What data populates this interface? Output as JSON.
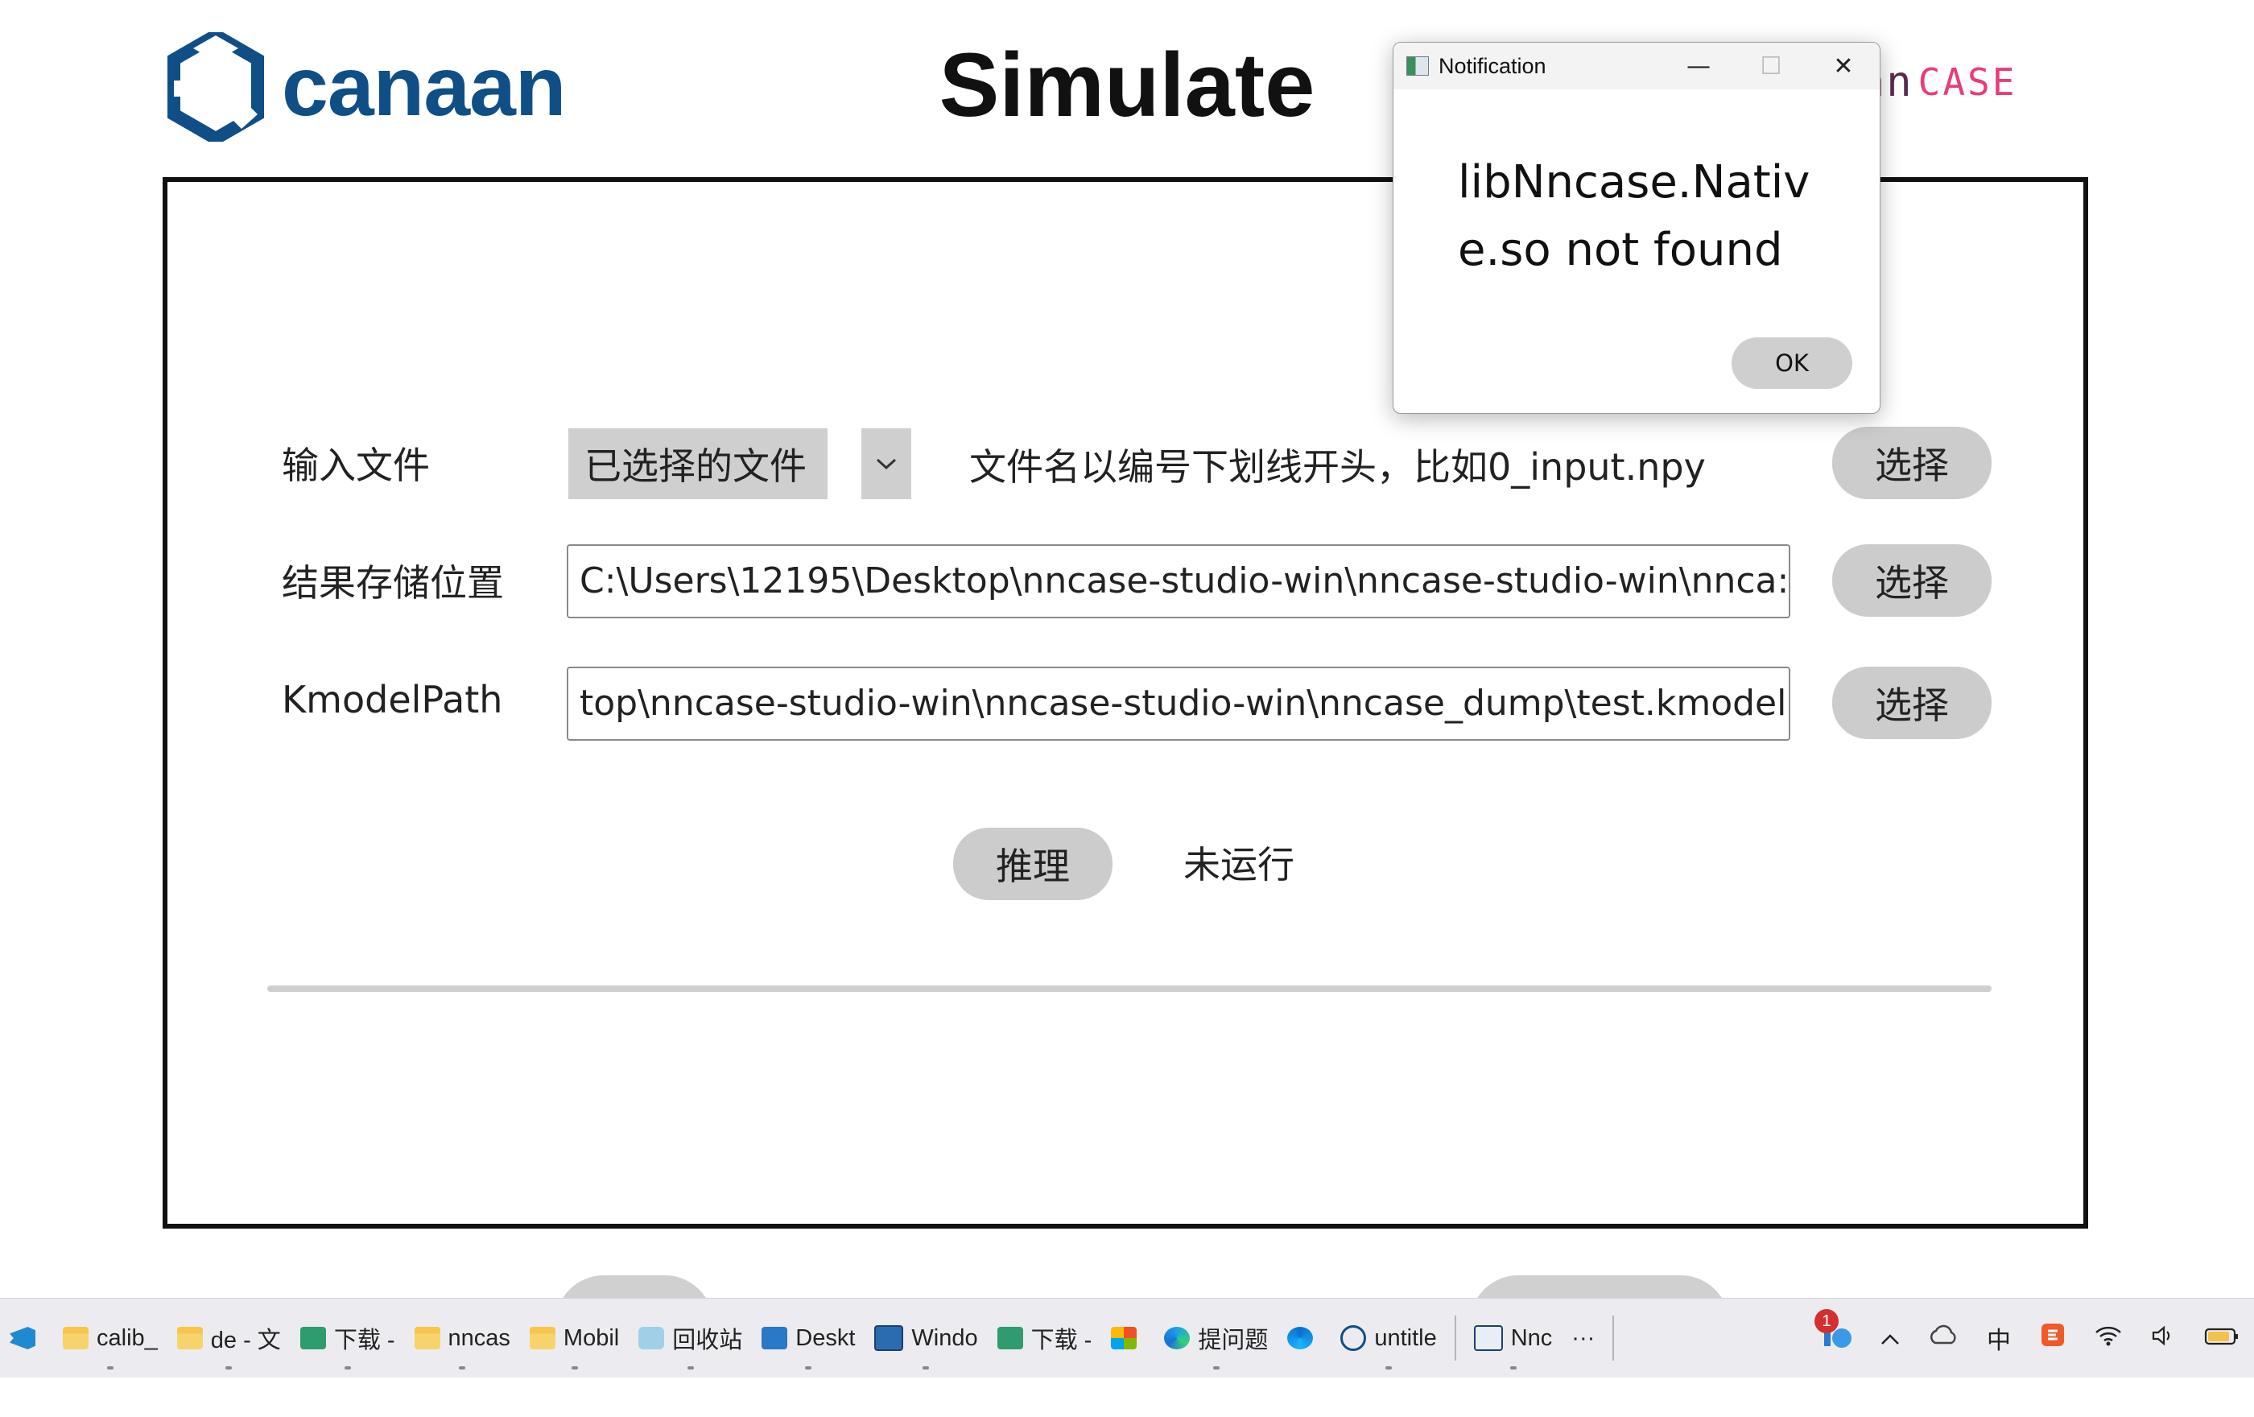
{
  "header": {
    "brand": "canaan",
    "page_title": "Simulate",
    "nncase_logo_nn": "nn",
    "nncase_logo_case": "CASE"
  },
  "form": {
    "input_file": {
      "label": "输入文件",
      "selected": "已选择的文件",
      "hint": "文件名以编号下划线开头，比如0_input.npy",
      "button": "选择"
    },
    "result_location": {
      "label": "结果存储位置",
      "value": "C:\\Users\\12195\\Desktop\\nncase-studio-win\\nncase-studio-win\\nnca:",
      "button": "选择"
    },
    "kmodel_path": {
      "label": "KmodelPath",
      "value": "top\\nncase-studio-win\\nncase-studio-win\\nncase_dump\\test.kmodel",
      "button": "选择"
    },
    "infer_button": "推理",
    "status": "未运行",
    "progress": 0
  },
  "dialog": {
    "title": "Notification",
    "message": "libNncase.Native.so not found",
    "ok": "OK",
    "minimize_glyph": "—",
    "maximize_glyph": "☐",
    "close_glyph": "✕"
  },
  "taskbar": {
    "items": [
      "calib_",
      "de - 文",
      "下载 -",
      "nncas",
      "Mobil",
      "回收站",
      "Deskt",
      "Windo",
      "下载 -",
      "提问题",
      "untitle",
      "Nnc"
    ],
    "overflow": "···",
    "ime": "中",
    "notification_count": "1"
  }
}
